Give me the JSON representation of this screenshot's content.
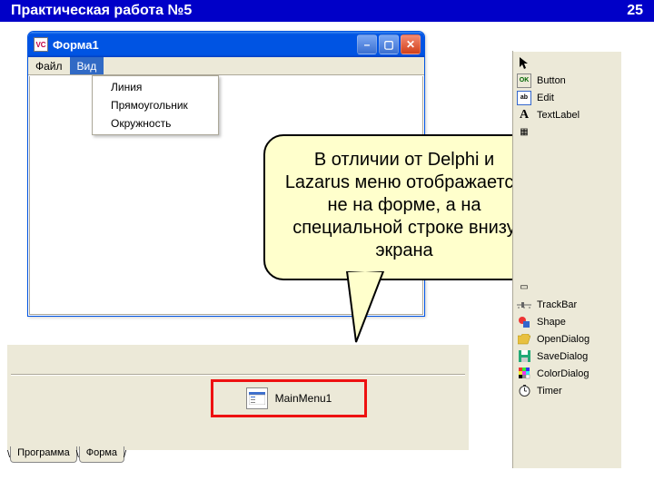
{
  "header": {
    "title": "Практическая работа №5",
    "page": "25"
  },
  "window": {
    "title": "Форма1",
    "menu": {
      "file": "Файл",
      "view": "Вид"
    },
    "dropdown": [
      "Линия",
      "Прямоугольник",
      "Окружность"
    ]
  },
  "callout": "В отличии от Delphi и Lazarus меню отображается не на форме, а на специальной строке внизу экрана",
  "component": {
    "label": "MainMenu1"
  },
  "tabs": {
    "program": "Программа",
    "form": "Форма"
  },
  "palette": [
    {
      "name": "cursor",
      "label": ""
    },
    {
      "name": "button",
      "label": "Button"
    },
    {
      "name": "edit",
      "label": "Edit"
    },
    {
      "name": "textlabel",
      "label": "TextLabel"
    },
    {
      "name": "powerpoint",
      "label": ""
    },
    {
      "name": "blank1",
      "label": ""
    },
    {
      "name": "blank2",
      "label": ""
    },
    {
      "name": "blank3",
      "label": ""
    },
    {
      "name": "blank4",
      "label": ""
    },
    {
      "name": "blank5",
      "label": ""
    },
    {
      "name": "blank6",
      "label": ""
    },
    {
      "name": "blank7",
      "label": ""
    },
    {
      "name": "blank8",
      "label": ""
    },
    {
      "name": "blank9",
      "label": ""
    },
    {
      "name": "trackbar",
      "label": "TrackBar"
    },
    {
      "name": "shape",
      "label": "Shape"
    },
    {
      "name": "opendialog",
      "label": "OpenDialog"
    },
    {
      "name": "savedialog",
      "label": "SaveDialog"
    },
    {
      "name": "colordialog",
      "label": "ColorDialog"
    },
    {
      "name": "timer",
      "label": "Timer"
    }
  ]
}
